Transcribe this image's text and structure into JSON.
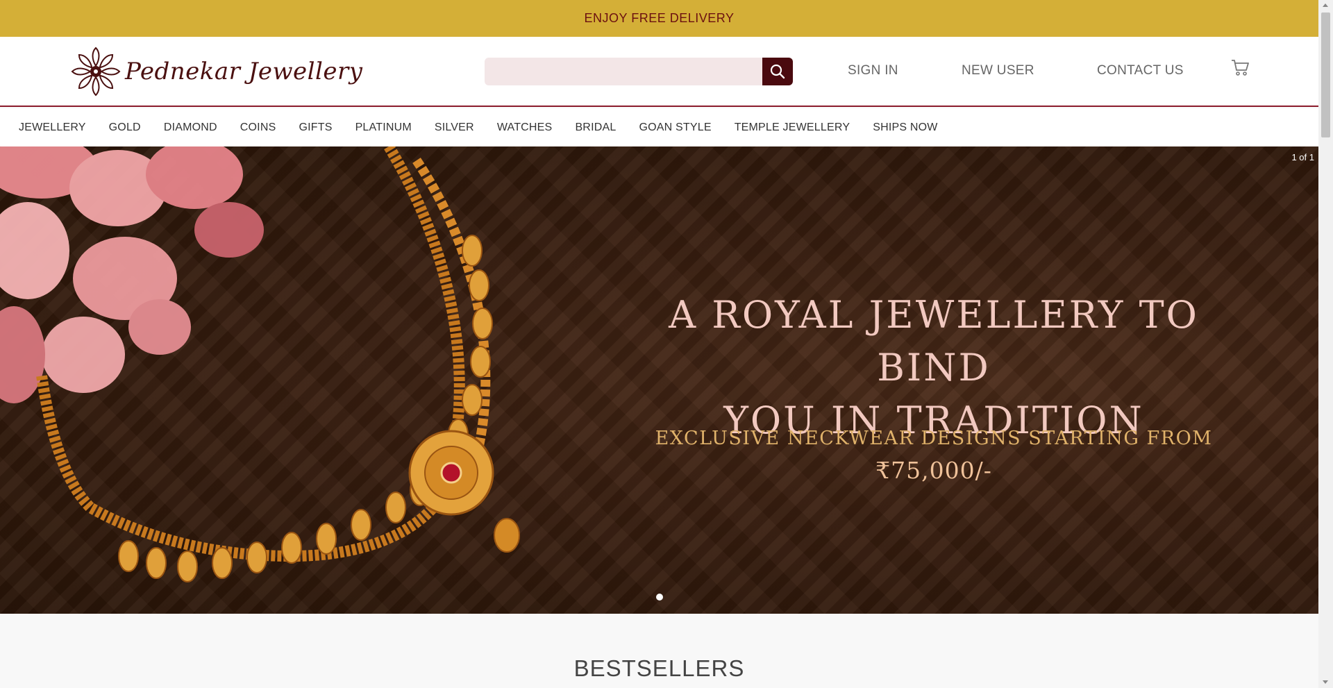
{
  "topbar": {
    "text": "ENJOY FREE DELIVERY"
  },
  "header": {
    "logo_text": "Pednekar Jewellery",
    "search": {
      "placeholder": "",
      "value": ""
    },
    "links": {
      "sign_in": "SIGN IN",
      "new_user": "NEW USER",
      "contact_us": "CONTACT US"
    },
    "icons": {
      "search": "search-icon",
      "cart": "cart-icon"
    }
  },
  "nav": {
    "items": [
      "JEWELLERY",
      "GOLD",
      "DIAMOND",
      "COINS",
      "GIFTS",
      "PLATINUM",
      "SILVER",
      "WATCHES",
      "BRIDAL",
      "GOAN STYLE",
      "TEMPLE JEWELLERY",
      "SHIPS NOW"
    ]
  },
  "hero": {
    "title_line1": "A ROYAL JEWELLERY TO BIND",
    "title_line2": "YOU IN TRADITION",
    "subtitle": "EXCLUSIVE NECKWEAR DESIGNS STARTING FROM",
    "price": "₹75,000/-",
    "slide_counter": "1 of 1"
  },
  "section": {
    "title": "BESTSELLERS"
  },
  "colors": {
    "topbar": "#d4af37",
    "brand": "#4a0a0f",
    "accent_line": "#8b1a2b",
    "topbar_text": "#6b1010"
  }
}
